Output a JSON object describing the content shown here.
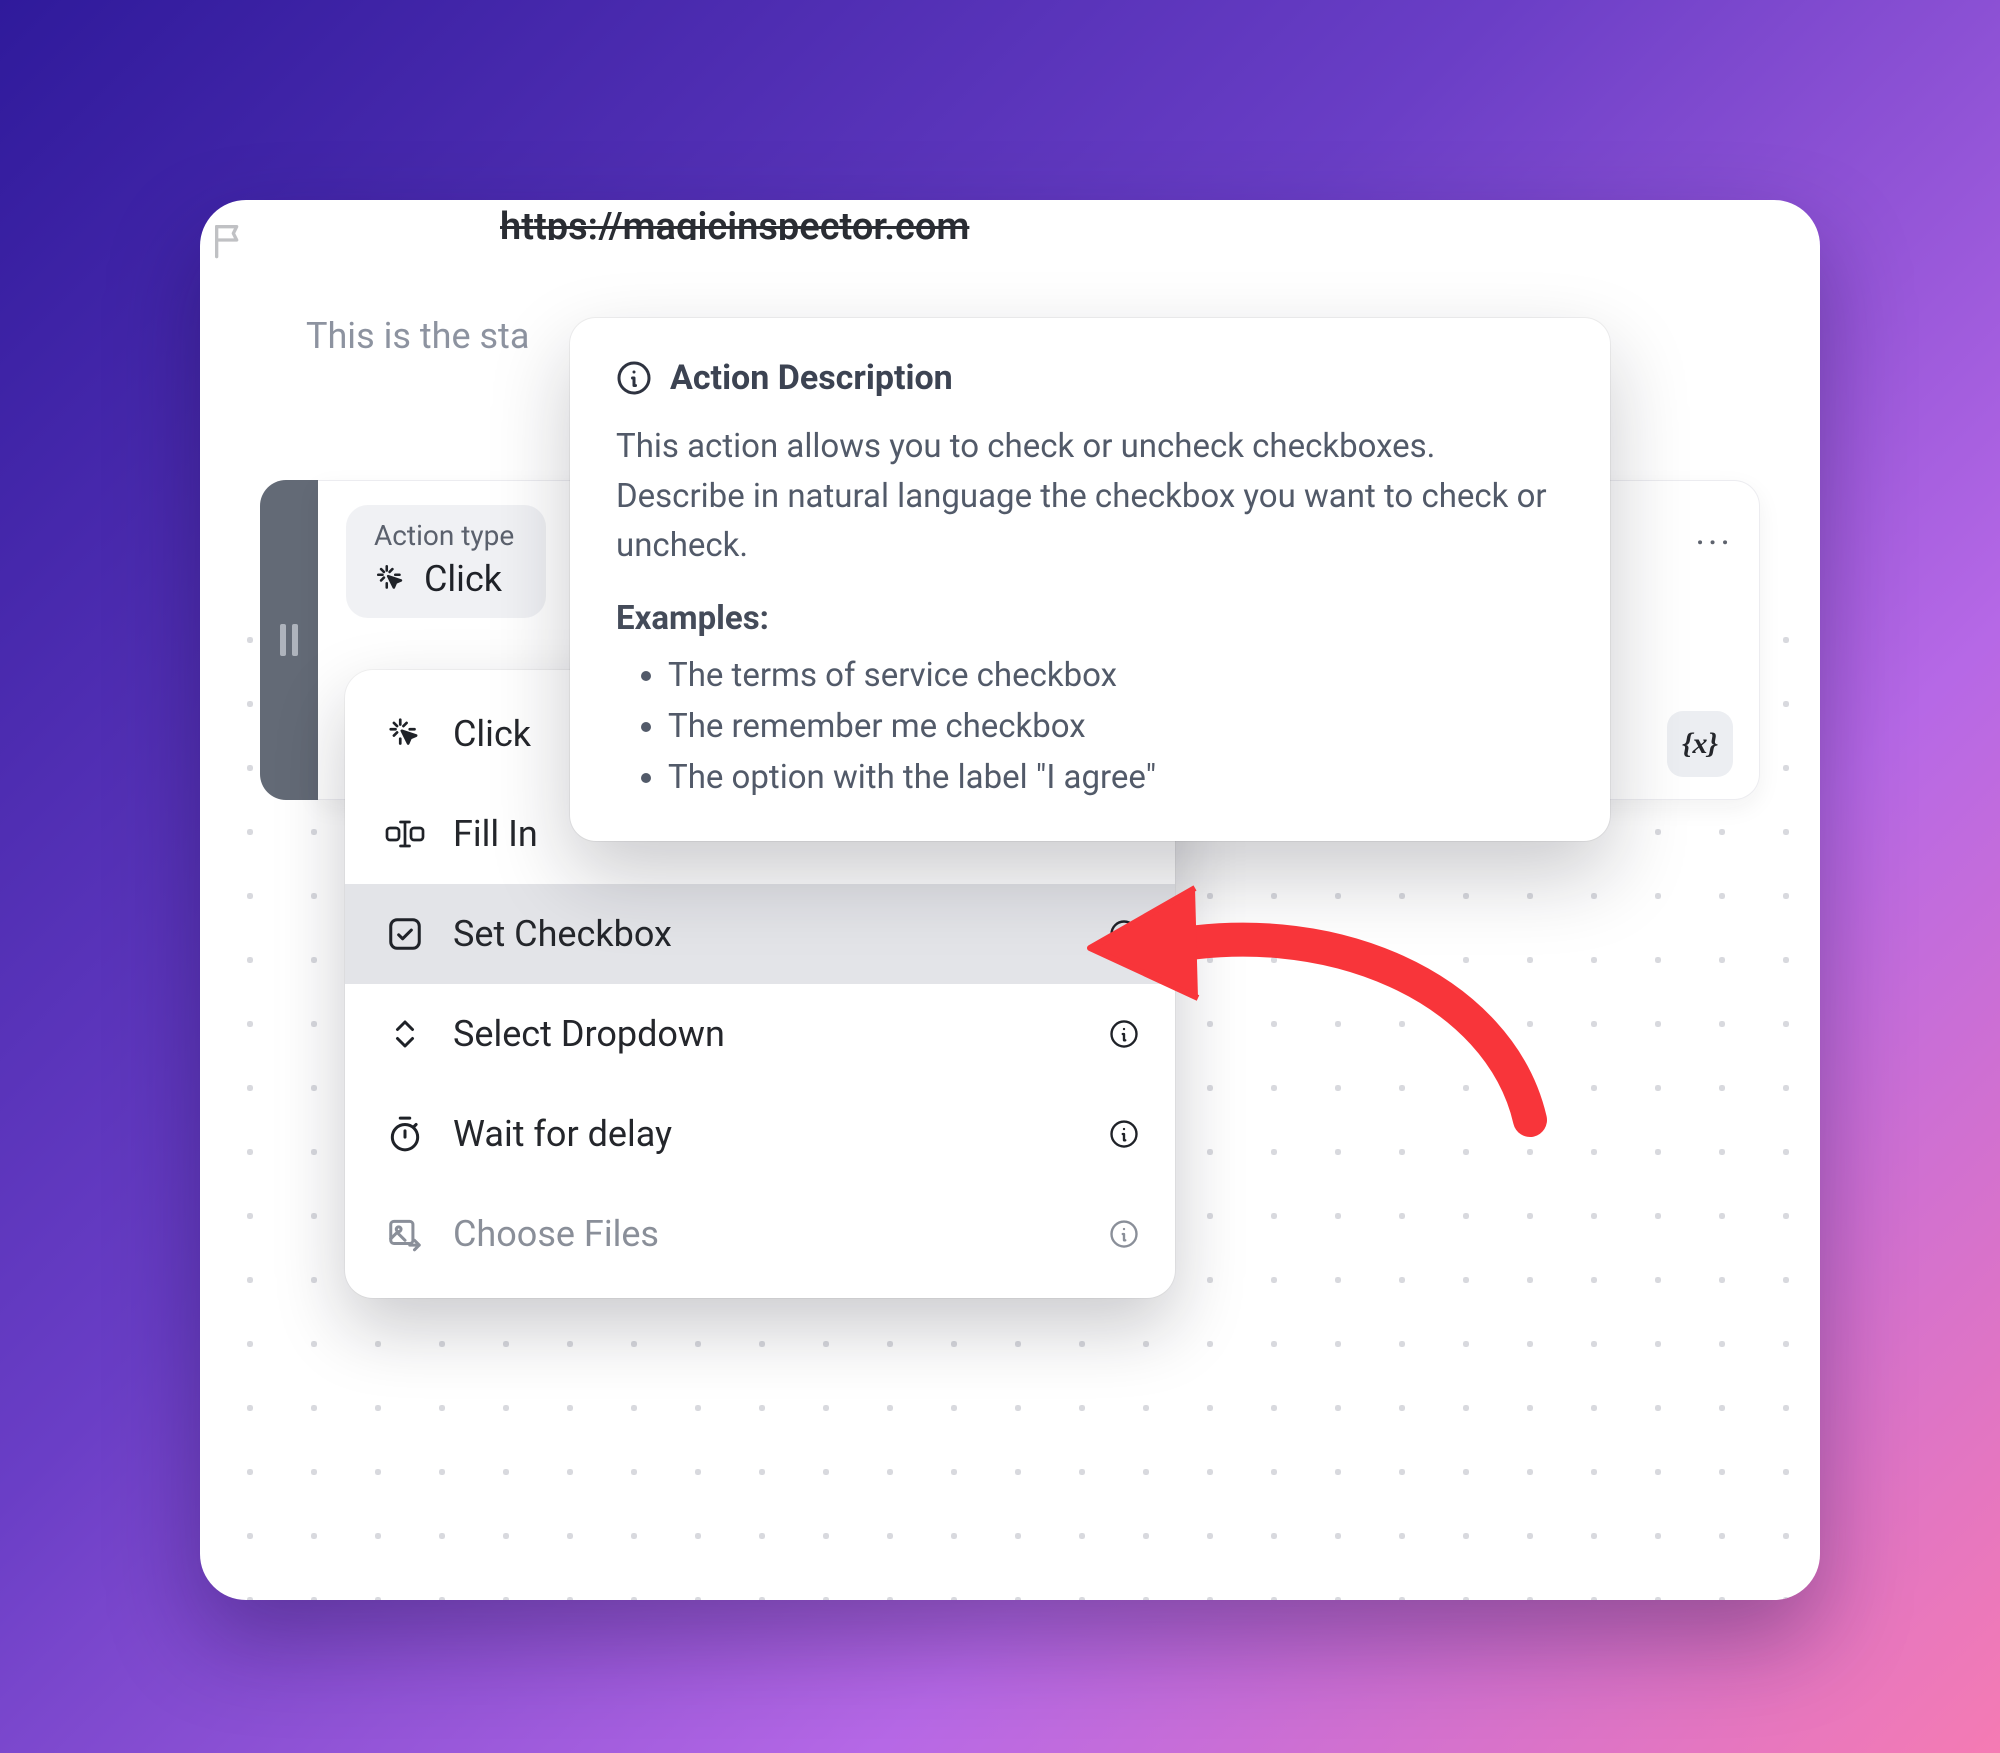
{
  "url": "https://magicinspector.com",
  "starting_text": "This is the sta",
  "step": {
    "action_type_label": "Action type",
    "action_type_value": "Click",
    "more": "...",
    "variable_chip": "{x}"
  },
  "dropdown": {
    "items": [
      {
        "label": "Click"
      },
      {
        "label": "Fill In"
      },
      {
        "label": "Set Checkbox"
      },
      {
        "label": "Select Dropdown"
      },
      {
        "label": "Wait for delay"
      },
      {
        "label": "Choose Files"
      }
    ]
  },
  "popover": {
    "title": "Action Description",
    "body": "This action allows you to check or uncheck checkboxes. Describe in natural language the checkbox you want to check or uncheck.",
    "examples_label": "Examples:",
    "examples": [
      "The terms of service checkbox",
      "The remember me checkbox",
      "The option with the label \"I agree\""
    ]
  }
}
